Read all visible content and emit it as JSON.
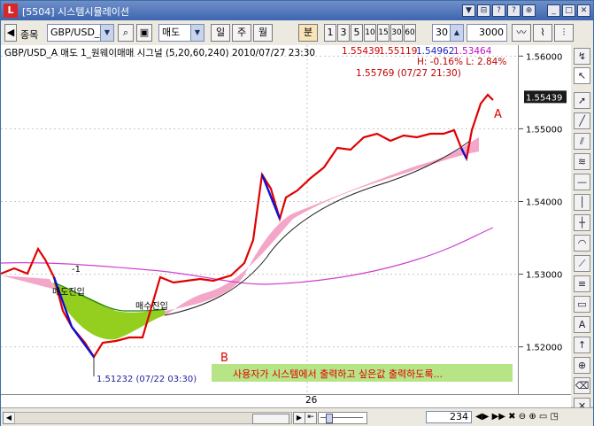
{
  "window": {
    "title": "[5504]  시스템시뮬레이션",
    "app_icon": "L",
    "controls": [
      "pin",
      "restore-small",
      "help",
      "restore",
      "maximize",
      "close"
    ]
  },
  "toolbar": {
    "item_label": "종목",
    "symbol": "GBP/USD_A",
    "side": "매도",
    "period_day": "일",
    "period_week": "주",
    "period_month": "월",
    "minute": "분",
    "minute_options": [
      "1",
      "3",
      "5",
      "10",
      "15",
      "30",
      "60"
    ],
    "interval_value": "30",
    "count_value": "3000"
  },
  "info": {
    "title": "GBP/USD_A 매도  1_원웨이매매 시그널  (5,20,60,240)  2010/07/27 23:30",
    "p1": "1.55439",
    "p2": "1.55119",
    "p3": "1.54962",
    "p4": "1.53464",
    "hl": "H: -0.16%  L: 2.84%",
    "last": "1.55769 (07/27 21:30)"
  },
  "chart_data": {
    "type": "line",
    "ylim": [
      1.5135,
      1.5615
    ],
    "yticks": [
      "1.56000",
      "1.55000",
      "1.54000",
      "1.53000",
      "1.52000"
    ],
    "current_price": "1.55439",
    "xtick": "26",
    "annotations": {
      "signal_minus1": "-1",
      "buy_entry_left": "매도진입",
      "buy_entry_mid": "매수진입",
      "low_label": "1.51232 (07/22 03:30)",
      "marker_a": "A",
      "marker_b": "B",
      "user_message": "사용자가 시스템에서 출력하고 싶은값 출력하도록..."
    },
    "colors": {
      "price": "#e00000",
      "down": "#1010d0",
      "cloud_pink": "#f4a6c8",
      "cloud_green": "#8ecc14",
      "ma_long": "#d040d0",
      "ma_mid": "#202020"
    }
  },
  "statusbar": {
    "count": "234"
  }
}
